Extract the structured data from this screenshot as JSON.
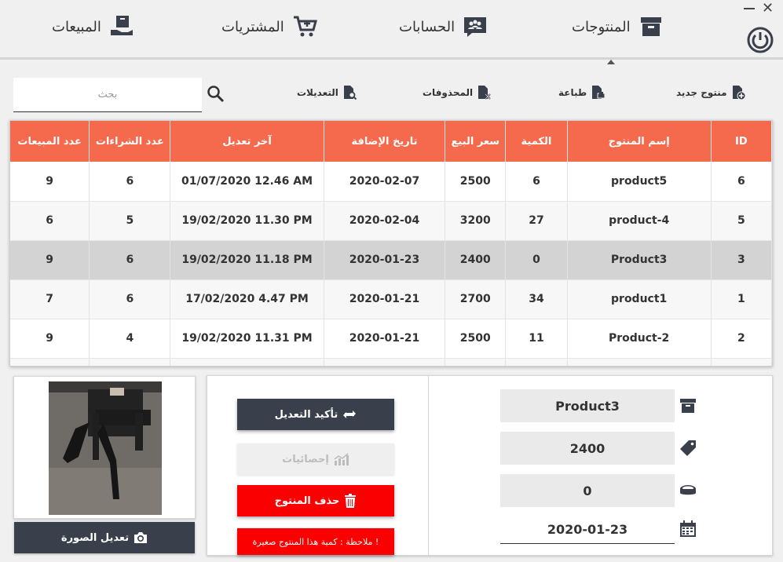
{
  "nav": {
    "products": "المنتوجات",
    "accounts": "الحسابات",
    "purchases": "المشتريات",
    "sales": "المبيعات"
  },
  "window": {
    "minimize": "—",
    "close": "✕"
  },
  "toolbar": {
    "new_product": "منتوج جديد",
    "print": "طباعة",
    "deleted": "المحذوفات",
    "edits": "التعديلات",
    "search_placeholder": "بحث"
  },
  "table": {
    "headers": [
      "عدد المبيعات",
      "عدد الشراءات",
      "آخر تعديل",
      "تاريخ الإضافة",
      "سعر البيع",
      "الكمية",
      "إسم المنتوج",
      "ID"
    ],
    "rows": [
      [
        "9",
        "6",
        "01/07/2020 12.46 AM",
        "2020-02-07",
        "2500",
        "6",
        "product5",
        "6"
      ],
      [
        "6",
        "5",
        "19/02/2020 11.30 PM",
        "2020-02-04",
        "3200",
        "27",
        "product-4",
        "5"
      ],
      [
        "9",
        "6",
        "19/02/2020 11.18 PM",
        "2020-01-23",
        "2400",
        "0",
        "Product3",
        "3"
      ],
      [
        "7",
        "6",
        "17/02/2020 4.47 PM",
        "2020-01-21",
        "2700",
        "34",
        "product1",
        "1"
      ],
      [
        "9",
        "4",
        "19/02/2020 11.31 PM",
        "2020-01-21",
        "2500",
        "11",
        "Product-2",
        "2"
      ]
    ],
    "selected_row": 2
  },
  "image_panel": {
    "edit_image": "تعديل الصورة"
  },
  "actions": {
    "confirm": "تأكيد التعديل",
    "stats": "إحصائيات",
    "delete": "حذف المنتوج",
    "note": "ملاحظة : كمية هذا المنتوج صغيرة !"
  },
  "form": {
    "name": "Product3",
    "price": "2400",
    "quantity": "0",
    "date": "2020-01-23"
  },
  "colors": {
    "header": "#f56a4d",
    "dark_button": "#3a404b",
    "danger": "#fb0000",
    "selected_row": "#d3d3d3"
  }
}
